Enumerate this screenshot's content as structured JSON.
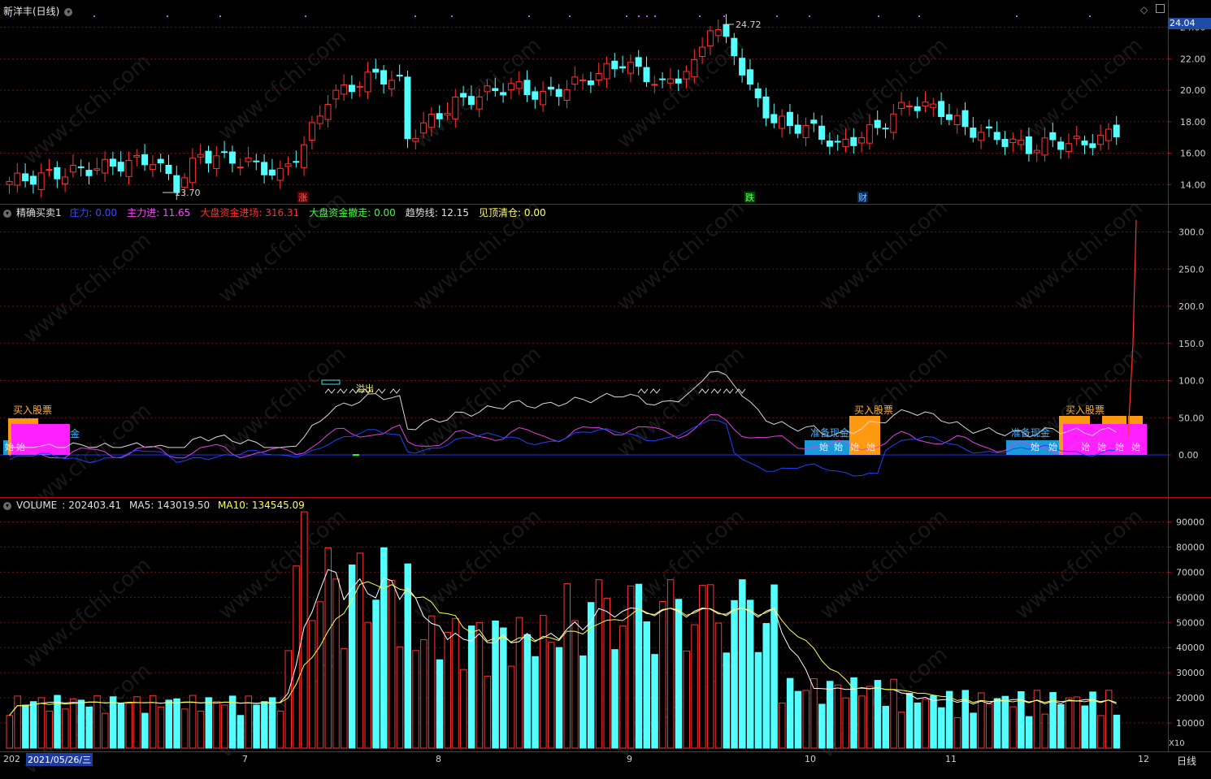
{
  "main_pane": {
    "title": "新洋丰(日线)",
    "high_label": "24.72",
    "low_label": "13.70",
    "current_price_tag": "24.04",
    "y_ticks": [
      "24.00",
      "22.00",
      "20.00",
      "18.00",
      "16.00",
      "14.00"
    ],
    "markers": {
      "up": "涨",
      "down": "跌",
      "finance": "财"
    },
    "colors": {
      "up": "#ff3232",
      "down": "#54ffff"
    }
  },
  "indicator_pane": {
    "name": "精确买卖1",
    "fields": [
      {
        "label": "庄力",
        "sep": ":",
        "value": "0.00",
        "color": "#3a4bff"
      },
      {
        "label": "主力进",
        "sep": ":",
        "value": "11.65",
        "color": "#ff44ff"
      },
      {
        "label": "大盘资金进场",
        "sep": ":",
        "value": "316.31",
        "color": "#ff3030"
      },
      {
        "label": "大盘资金撤走",
        "sep": ":",
        "value": "0.00",
        "color": "#40ff40"
      },
      {
        "label": "趋势线",
        "sep": ":",
        "value": "12.15",
        "color": "#e0e0e0"
      },
      {
        "label": "见顶清仓",
        "sep": ":",
        "value": "0.00",
        "color": "#ffff66"
      }
    ],
    "y_ticks": [
      "300.0",
      "250.0",
      "200.0",
      "150.0",
      "100.0",
      "50.00",
      "0.00"
    ],
    "signals": {
      "buy": "买入股票",
      "cash": "准备现金",
      "cash_partial": "金",
      "start": "始",
      "overflow": "溢出"
    }
  },
  "volume_pane": {
    "name": "VOLUME",
    "value": "202403.41",
    "ma5_label": "MA5",
    "ma5": "143019.50",
    "ma10_label": "MA10",
    "ma10": "134545.09",
    "y_ticks": [
      "90000",
      "80000",
      "70000",
      "60000",
      "50000",
      "40000",
      "30000",
      "20000",
      "10000"
    ],
    "multiplier": "X10"
  },
  "time_axis": {
    "year_prefix": "202",
    "selected_date": "2021/05/26/三",
    "months": [
      "7",
      "8",
      "9",
      "10",
      "11",
      "12"
    ],
    "period": "日线"
  },
  "watermark": "www.cfchi.com"
}
